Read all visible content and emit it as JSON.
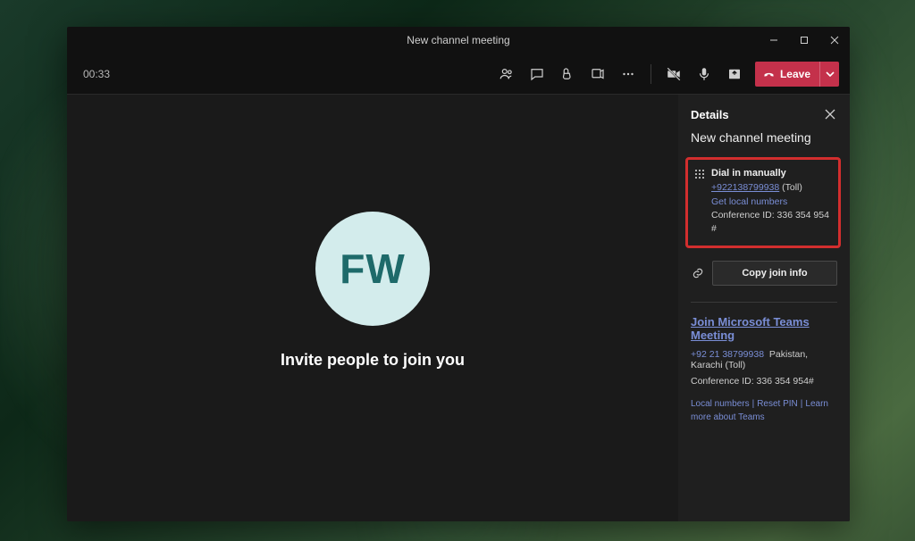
{
  "window": {
    "title": "New channel meeting"
  },
  "toolbar": {
    "timer": "00:33",
    "leave_label": "Leave"
  },
  "stage": {
    "initials": "FW",
    "invite_prompt": "Invite people to join you"
  },
  "details": {
    "panel_title": "Details",
    "meeting_name": "New channel meeting",
    "dial_in": {
      "heading": "Dial in manually",
      "phone_display": "+922138799938",
      "toll_suffix": " (Toll)",
      "local_numbers": "Get local numbers",
      "conf_id_line": "Conference ID: 336 354 954 #"
    },
    "copy_button": "Copy join info",
    "join_link": "Join Microsoft Teams Meeting",
    "phone_formatted": "+92 21 38799938",
    "region": "Pakistan, Karachi (Toll)",
    "conf_id_2": "Conference ID: 336 354 954#",
    "links": {
      "local": "Local numbers",
      "reset": "Reset PIN",
      "learn": "Learn more about Teams"
    }
  }
}
